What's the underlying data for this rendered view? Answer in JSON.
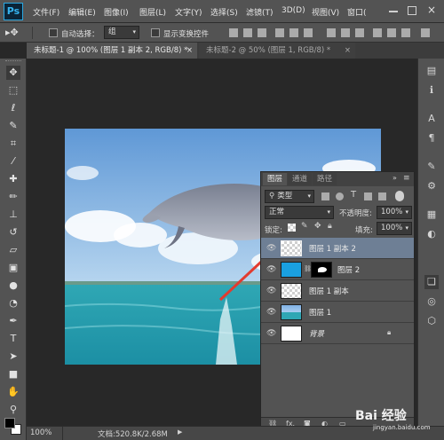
{
  "app": {
    "logo": "Ps"
  },
  "menu": [
    "文件(F)",
    "编辑(E)",
    "图像(I)",
    "图层(L)",
    "文字(Y)",
    "选择(S)",
    "滤镜(T)",
    "3D(D)",
    "视图(V)",
    "窗口("
  ],
  "options": {
    "auto_select_label": "自动选择：",
    "auto_select_value": "组",
    "show_transform_label": "显示变换控件"
  },
  "tabs": [
    {
      "label": "未标题-1 @ 100% (图层 1 副本 2, RGB/8) *",
      "close": "×",
      "active": true
    },
    {
      "label": "未标题-2 @ 50% (图层 1, RGB/8) *",
      "close": "×",
      "active": false
    }
  ],
  "status": {
    "zoom": "100%",
    "doc_info": "文档:520.8K/2.68M"
  },
  "layers_panel": {
    "tabs": [
      "图层",
      "通道",
      "路径"
    ],
    "filter_kind": "类型",
    "blend_mode": "正常",
    "opacity_label": "不透明度:",
    "opacity_value": "100%",
    "lock_label": "锁定:",
    "fill_label": "填充:",
    "fill_value": "100%",
    "layers": [
      {
        "name": "图层 1 副本 2",
        "selected": true
      },
      {
        "name": "图层 2",
        "selected": false
      },
      {
        "name": "图层 1 副本",
        "selected": false
      },
      {
        "name": "图层 1",
        "selected": false
      },
      {
        "name": "背景",
        "selected": false,
        "locked": true
      }
    ],
    "footer_fx": "fx."
  },
  "watermark": {
    "text": "Bai 经验",
    "sub": "jingyan.baidu.com"
  },
  "colors": {
    "chrome": "#535353",
    "canvas_bg": "#282828",
    "selected_layer": "#6e7f95",
    "annotation_arrow": "#e23b2f"
  }
}
